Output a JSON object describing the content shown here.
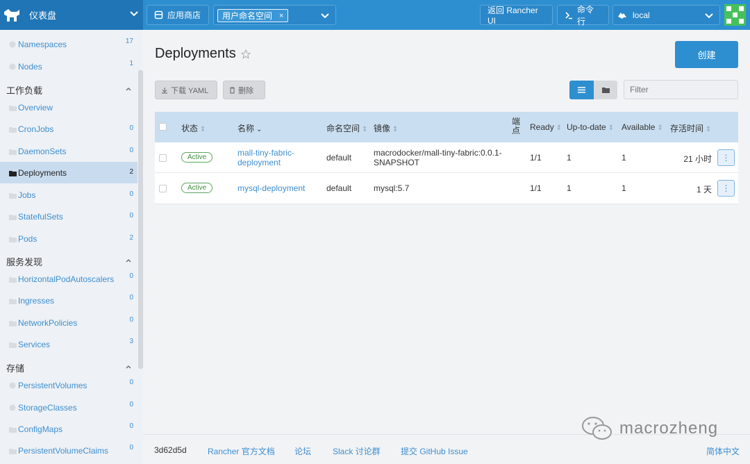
{
  "header": {
    "dashboard_label": "仪表盘",
    "app_store_label": "应用商店",
    "namespace_tag": "用户命名空间",
    "namespace_tag_close": "×",
    "back_rancher_label": "返回 Rancher UI",
    "kubectl_label": "命令行",
    "cluster_label": "local"
  },
  "sidebar": {
    "top_items": [
      {
        "label": "Namespaces",
        "count": "17"
      },
      {
        "label": "Nodes",
        "count": "1"
      }
    ],
    "sections": [
      {
        "title": "工作负载",
        "items": [
          {
            "label": "Overview",
            "count": ""
          },
          {
            "label": "CronJobs",
            "count": "0"
          },
          {
            "label": "DaemonSets",
            "count": "0"
          },
          {
            "label": "Deployments",
            "count": "2"
          },
          {
            "label": "Jobs",
            "count": "0"
          },
          {
            "label": "StatefulSets",
            "count": "0"
          },
          {
            "label": "Pods",
            "count": "2"
          }
        ]
      },
      {
        "title": "服务发现",
        "items": [
          {
            "label": "HorizontalPodAutoscalers",
            "count": "0"
          },
          {
            "label": "Ingresses",
            "count": "0"
          },
          {
            "label": "NetworkPolicies",
            "count": "0"
          },
          {
            "label": "Services",
            "count": "3"
          }
        ]
      },
      {
        "title": "存储",
        "items": [
          {
            "label": "PersistentVolumes",
            "count": "0"
          },
          {
            "label": "StorageClasses",
            "count": "0"
          },
          {
            "label": "ConfigMaps",
            "count": "0"
          },
          {
            "label": "PersistentVolumeClaims",
            "count": "0"
          }
        ]
      }
    ]
  },
  "main": {
    "title": "Deployments",
    "create_label": "创建",
    "download_yaml_label": "下载 YAML",
    "delete_label": "删除",
    "filter_placeholder": "Filter",
    "columns": [
      "状态",
      "名称",
      "命名空间",
      "镜像",
      "端点",
      "Ready",
      "Up-to-date",
      "Available",
      "存活时间"
    ],
    "rows": [
      {
        "status": "Active",
        "name": [
          "mall-tiny-fabric-",
          "deployment"
        ],
        "namespace": "default",
        "image": [
          "macrodocker/mall-tiny-fabric:0.0.1-",
          "SNAPSHOT"
        ],
        "ready": "1/1",
        "uptodate": "1",
        "available": "1",
        "age": "21 小时"
      },
      {
        "status": "Active",
        "name": [
          "mysql-deployment"
        ],
        "namespace": "default",
        "image": [
          "mysql:5.7"
        ],
        "ready": "1/1",
        "uptodate": "1",
        "available": "1",
        "age": "1 天"
      }
    ]
  },
  "footer": {
    "version": "3d62d5d",
    "docs": "Rancher 官方文档",
    "forum": "论坛",
    "slack": "Slack 讨论群",
    "issue": "提交 GitHub Issue",
    "language": "简体中文"
  },
  "watermark": "macrozheng",
  "colors": {
    "primary": "#2e8fd0",
    "sidebar_active": "#c9dcef",
    "status_active": "#5aa55a"
  }
}
